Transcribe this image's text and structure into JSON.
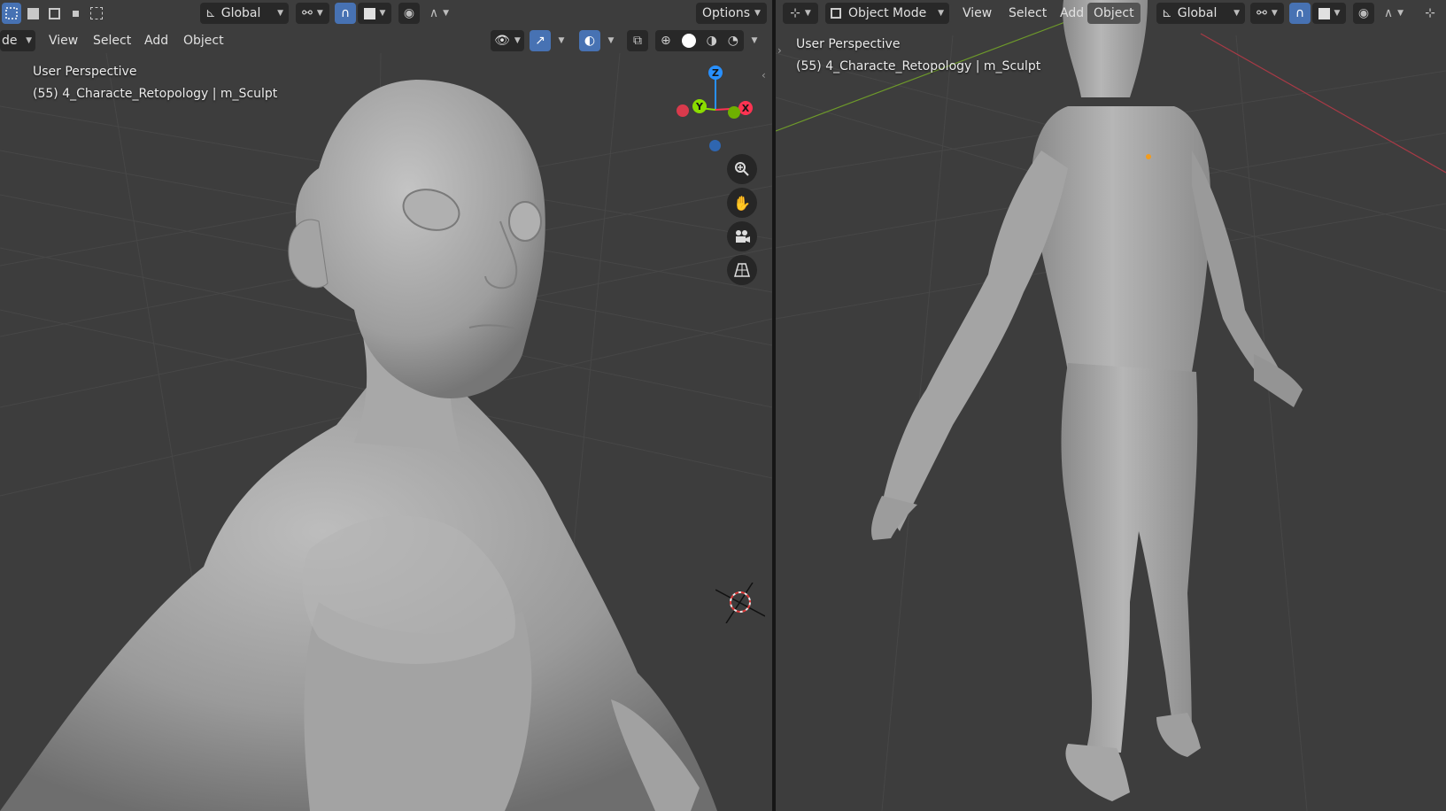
{
  "colors": {
    "viewport_bg": "#3d3d3d",
    "header_item_bg": "#282828",
    "active_blue": "#4772b3",
    "axis_x": "#ff3352",
    "axis_y": "#8bdc00",
    "axis_z": "#2890ff",
    "mesh_gray": "#9c9c9c"
  },
  "left_viewport": {
    "header_row1": {
      "orientation_label": "Global",
      "options_label": "Options"
    },
    "header_row2": {
      "mode_label_partial": "de",
      "menus": [
        "View",
        "Select",
        "Add",
        "Object"
      ]
    },
    "overlay": {
      "view_name": "User Perspective",
      "object_info": "(55) 4_Characte_Retopology | m_Sculpt"
    },
    "gizmo": {
      "axes": [
        "Z",
        "Y",
        "X"
      ]
    },
    "nav_buttons": [
      "zoom-icon",
      "hand-pan-icon",
      "camera-icon",
      "perspective-grid-icon"
    ]
  },
  "right_viewport": {
    "header": {
      "mode_label": "Object Mode",
      "menus": [
        "View",
        "Select",
        "Add",
        "Object"
      ],
      "active_menu": "Object",
      "orientation_label": "Global"
    },
    "overlay": {
      "view_name": "User Perspective",
      "object_info": "(55) 4_Characte_Retopology | m_Sculpt"
    }
  }
}
